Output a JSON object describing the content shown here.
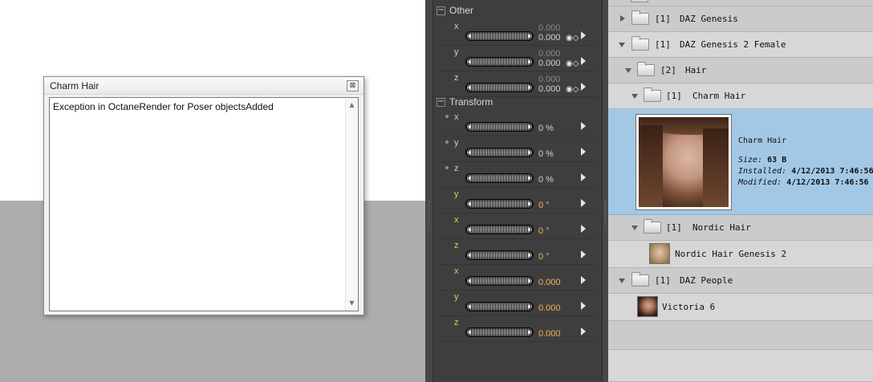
{
  "dialog": {
    "title": "Charm Hair",
    "close_glyph": "⊠",
    "message": "Exception in OctaneRender for Poser objectsAdded",
    "scroll_up_glyph": "▲",
    "scroll_down_glyph": "▼"
  },
  "params": {
    "groups": {
      "other": {
        "toggle": "−",
        "name": "Other"
      },
      "transform": {
        "toggle": "−",
        "name": "Transform"
      }
    },
    "rows": [
      {
        "label": "x",
        "value1": "0.000",
        "value2": "0.000",
        "key_glyph": "◉◇"
      },
      {
        "label": "y",
        "value1": "0.000",
        "value2": "0.000",
        "key_glyph": "◉◇"
      },
      {
        "label": "z",
        "value1": "0.000",
        "value2": "0.000",
        "key_glyph": "◉◇"
      },
      {
        "label": "x",
        "value2": "0 %"
      },
      {
        "label": "y",
        "value2": "0 %"
      },
      {
        "label": "z",
        "value2": "0 %"
      },
      {
        "label": "y",
        "value2": "0 °"
      },
      {
        "label": "x",
        "value2": "0 °"
      },
      {
        "label": "z",
        "value2": "0 °"
      },
      {
        "label": "x",
        "value2": "0.000"
      },
      {
        "label": "y",
        "value2": "0.000"
      },
      {
        "label": "z",
        "value2": "0.000"
      }
    ]
  },
  "library": {
    "rows": [
      {
        "count": "[1]",
        "name": "DAZ Genesis"
      },
      {
        "count": "[1]",
        "name": "DAZ Genesis 2 Female"
      },
      {
        "count": "[2]",
        "name": "Hair"
      },
      {
        "count": "[1]",
        "name": "Charm Hair"
      },
      {
        "count": "[1]",
        "name": "Nordic Hair"
      },
      {
        "name": "Nordic Hair Genesis 2"
      },
      {
        "count": "[1]",
        "name": "DAZ People"
      },
      {
        "name": "Victoria 6"
      }
    ],
    "selected": {
      "title": "Charm Hair",
      "size_label": "Size:",
      "size_value": "63 B",
      "installed_label": "Installed:",
      "installed_value": "4/12/2013 7:46:56",
      "modified_label": "Modified:",
      "modified_value": "4/12/2013 7:46:56"
    }
  },
  "colors": {
    "selection": "#a3c8e6",
    "panel_dark": "#3e3e3e",
    "accent_value": "#e8b860"
  }
}
